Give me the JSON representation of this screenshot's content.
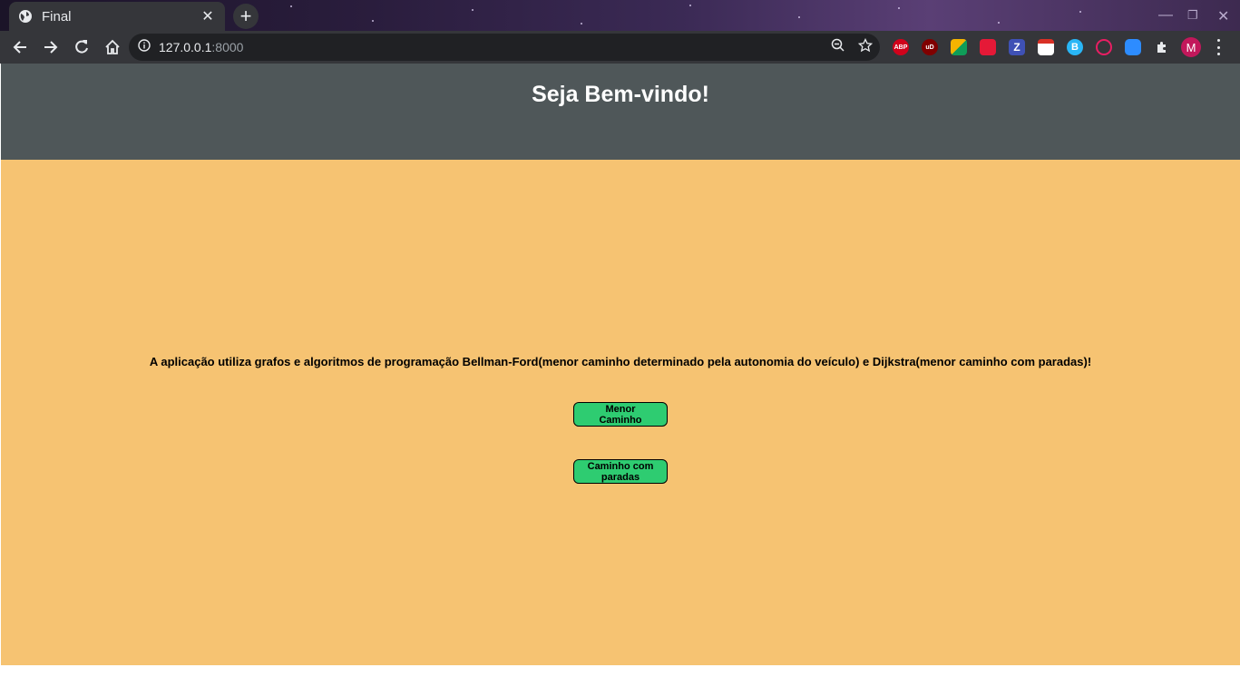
{
  "browser": {
    "tab_title": "Final",
    "tab_close": "✕",
    "new_tab": "+",
    "url_host": "127.0.0.1",
    "url_port": ":8000",
    "extensions": [
      {
        "name": "adblock-plus",
        "label": "ABP",
        "color": "#d0021b"
      },
      {
        "name": "ublock",
        "label": "uD",
        "color": "#800000"
      },
      {
        "name": "colorful-grid",
        "label": "",
        "color": "#f4b400"
      },
      {
        "name": "mendeley",
        "label": "",
        "color": "#e51937"
      },
      {
        "name": "zotero",
        "label": "Z",
        "color": "#3f51b5"
      },
      {
        "name": "calendar",
        "label": "",
        "color": "#d93025"
      },
      {
        "name": "b-extension",
        "label": "B",
        "color": "#29b6f6"
      },
      {
        "name": "download",
        "label": "",
        "color": "#e91e63"
      },
      {
        "name": "zoom",
        "label": "",
        "color": "#2d8cff"
      }
    ],
    "avatar_initial": "M"
  },
  "page": {
    "heading": "Seja Bem-vindo!",
    "description": "A aplicação utiliza grafos e algoritmos de programação Bellman-Ford(menor caminho determinado pela autonomia do veículo) e Dijkstra(menor caminho com paradas)!",
    "buttons": {
      "shortest_path": "Menor Caminho",
      "path_with_stops": "Caminho com paradas"
    },
    "colors": {
      "header": "#4f5759",
      "background": "#f6c372",
      "button": "#2ecc71"
    }
  }
}
